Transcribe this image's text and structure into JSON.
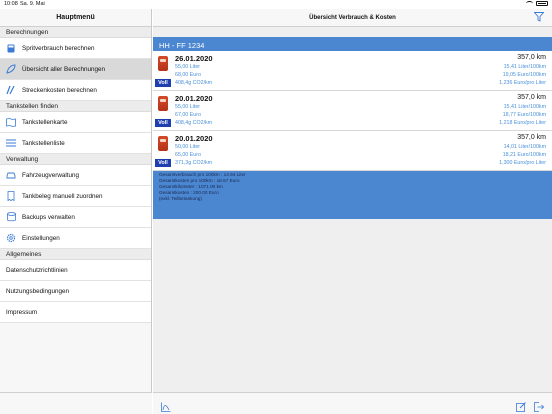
{
  "status": {
    "time": "10:08",
    "date": "Sa. 9. Mai"
  },
  "sidebar": {
    "title": "Hauptmenü",
    "sections": [
      {
        "label": "Berechnungen"
      },
      {
        "label": "Tankstellen finden"
      },
      {
        "label": "Verwaltung"
      },
      {
        "label": "Allgemeines"
      }
    ],
    "items": [
      {
        "label": "Spritverbrauch berechnen",
        "icon": "calculator-icon"
      },
      {
        "label": "Übersicht aller Berechnungen",
        "icon": "leaf-icon"
      },
      {
        "label": "Streckenkosten berechnen",
        "icon": "route-icon"
      },
      {
        "label": "Tankstellenkarte",
        "icon": "map-icon"
      },
      {
        "label": "Tankstellenliste",
        "icon": "list-icon"
      },
      {
        "label": "Fahrzeugverwaltung",
        "icon": "car-icon"
      },
      {
        "label": "Tankbeleg manuell zuordnen",
        "icon": "receipt-icon"
      },
      {
        "label": "Backups verwalten",
        "icon": "database-icon"
      },
      {
        "label": "Einstellungen",
        "icon": "gear-icon"
      },
      {
        "label": "Datenschutzrichtlinien"
      },
      {
        "label": "Nutzungsbedingungen"
      },
      {
        "label": "Impressum"
      }
    ]
  },
  "main": {
    "title": "Übersicht Verbrauch & Kosten",
    "plate": "HH - FF 1234",
    "entries": [
      {
        "date": "26.01.2020",
        "km": "357,0 km",
        "liter": "55,00 Liter",
        "euro": "68,00 Euro",
        "co2": "408,4g CO2/km",
        "per100": "15,41 Liter/100km",
        "eur100": "19,05 Euro/100km",
        "eurl": "1,236 Euro/pro Liter",
        "badge": "Voll"
      },
      {
        "date": "20.01.2020",
        "km": "357,0 km",
        "liter": "55,00 Liter",
        "euro": "67,00 Euro",
        "co2": "408,4g CO2/km",
        "per100": "15,41 Liter/100km",
        "eur100": "18,77 Euro/100km",
        "eurl": "1,218 Euro/pro Liter",
        "badge": "Voll"
      },
      {
        "date": "20.01.2020",
        "km": "357,0 km",
        "liter": "50,00 Liter",
        "euro": "65,00 Euro",
        "co2": "371,3g CO2/km",
        "per100": "14,01 Liter/100km",
        "eur100": "18,21 Euro/100km",
        "eurl": "1,300 Euro/pro Liter",
        "badge": "Voll"
      }
    ],
    "summary": [
      "Gesamtverbrauch pro 100km : 14.94 Liter",
      "Gesamtkosten pro 100km : 18.67 Euro",
      "Gesamtkilometer : 1071.00 km",
      "Gesamtkosten : 200.00 Euro",
      "(exkl. Teilbetankung)"
    ]
  },
  "colors": {
    "accent": "#4b86d0",
    "link": "#4a90d9",
    "badge": "#1d3fb0"
  }
}
